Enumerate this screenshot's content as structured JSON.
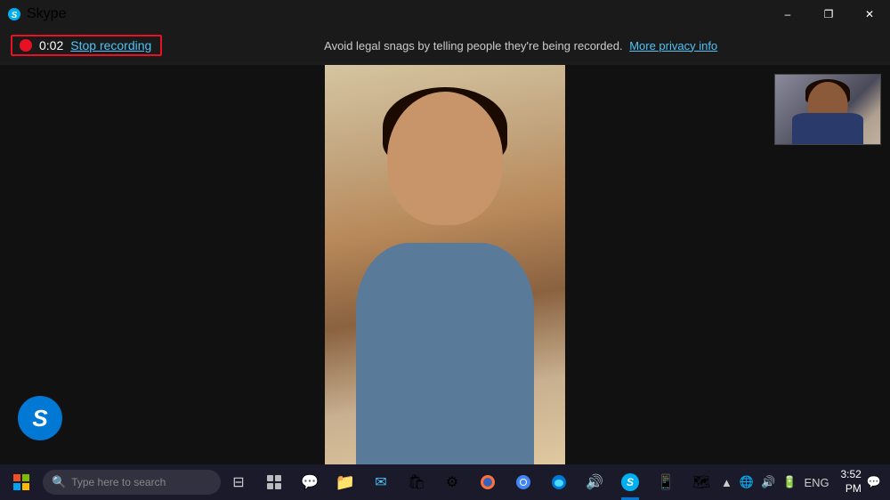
{
  "titlebar": {
    "title": "Skype",
    "minimize_label": "–",
    "restore_label": "❐",
    "close_label": "✕"
  },
  "recording": {
    "time": "0:02",
    "stop_label": "Stop recording",
    "notice_text": "Avoid legal snags by telling people they're being recorded.",
    "privacy_link_label": "More privacy info"
  },
  "skype_logo": "S",
  "taskbar": {
    "time": "3:52 PM",
    "language": "ENG",
    "search_placeholder": "Type here to search",
    "apps": [
      {
        "name": "start",
        "icon": "⊞"
      },
      {
        "name": "search",
        "icon": "🔍"
      },
      {
        "name": "task-view",
        "icon": "❑"
      },
      {
        "name": "widgets",
        "icon": "▦"
      },
      {
        "name": "chat",
        "icon": "💬"
      },
      {
        "name": "explorer",
        "icon": "📁"
      },
      {
        "name": "store",
        "icon": "🏪"
      },
      {
        "name": "mail",
        "icon": "✉"
      },
      {
        "name": "chrome",
        "icon": "🌐"
      },
      {
        "name": "edge",
        "icon": "🔵"
      },
      {
        "name": "firefox",
        "icon": "🦊"
      },
      {
        "name": "settings",
        "icon": "⚙"
      },
      {
        "name": "media",
        "icon": "🎵"
      },
      {
        "name": "skype",
        "icon": "S"
      },
      {
        "name": "app2",
        "icon": "📱"
      },
      {
        "name": "maps",
        "icon": "🗺"
      }
    ],
    "tray_icons": [
      "▲",
      "🔊",
      "🌐",
      "🔋",
      "ENG"
    ]
  }
}
